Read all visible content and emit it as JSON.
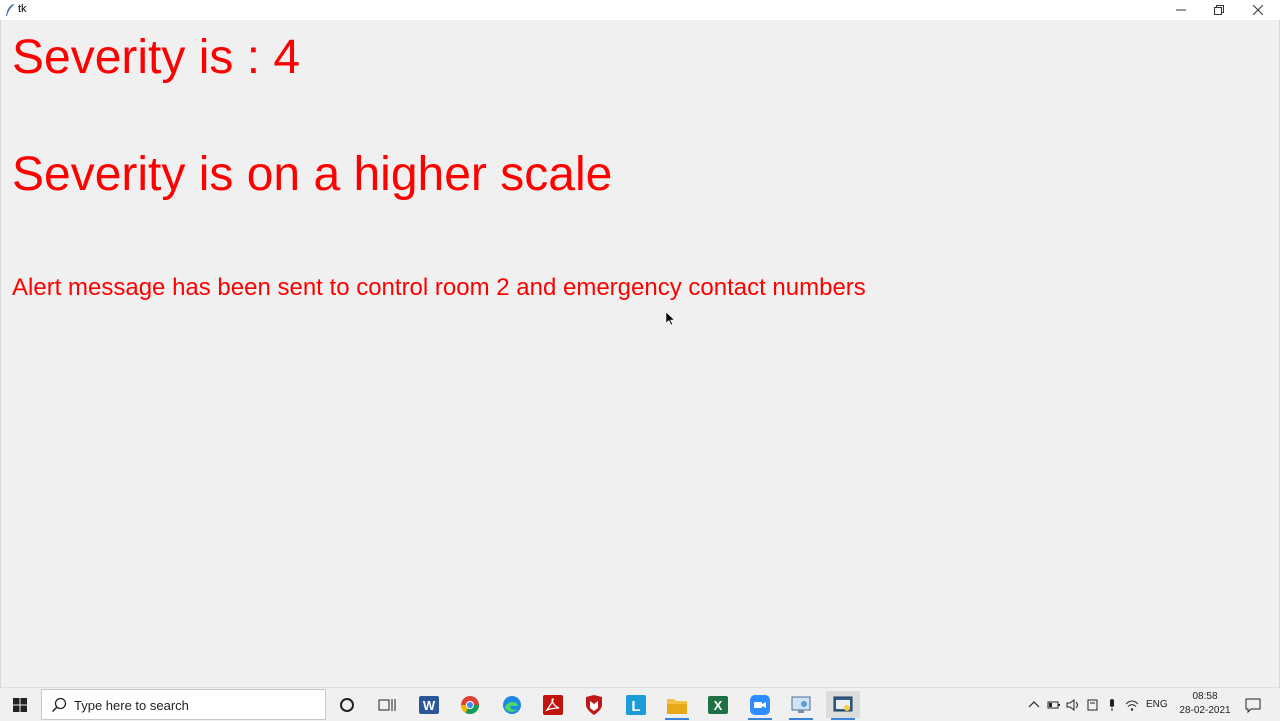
{
  "window": {
    "title": "tk"
  },
  "content": {
    "severity_label": "Severity is :  4",
    "scale_label": "Severity is on a higher scale",
    "alert_label": "Alert message has been sent to control room 2 and emergency contact numbers",
    "text_color": "#ff0000"
  },
  "taskbar": {
    "search_placeholder": "Type here to search",
    "pinned_apps": [
      "cortana",
      "task-view",
      "word",
      "chrome",
      "edge",
      "acrobat",
      "mcafee",
      "l-app",
      "file-explorer",
      "excel",
      "zoom",
      "control-panel",
      "python-tk"
    ],
    "tray": {
      "language": "ENG",
      "time": "08:58",
      "date": "28-02-2021"
    }
  }
}
